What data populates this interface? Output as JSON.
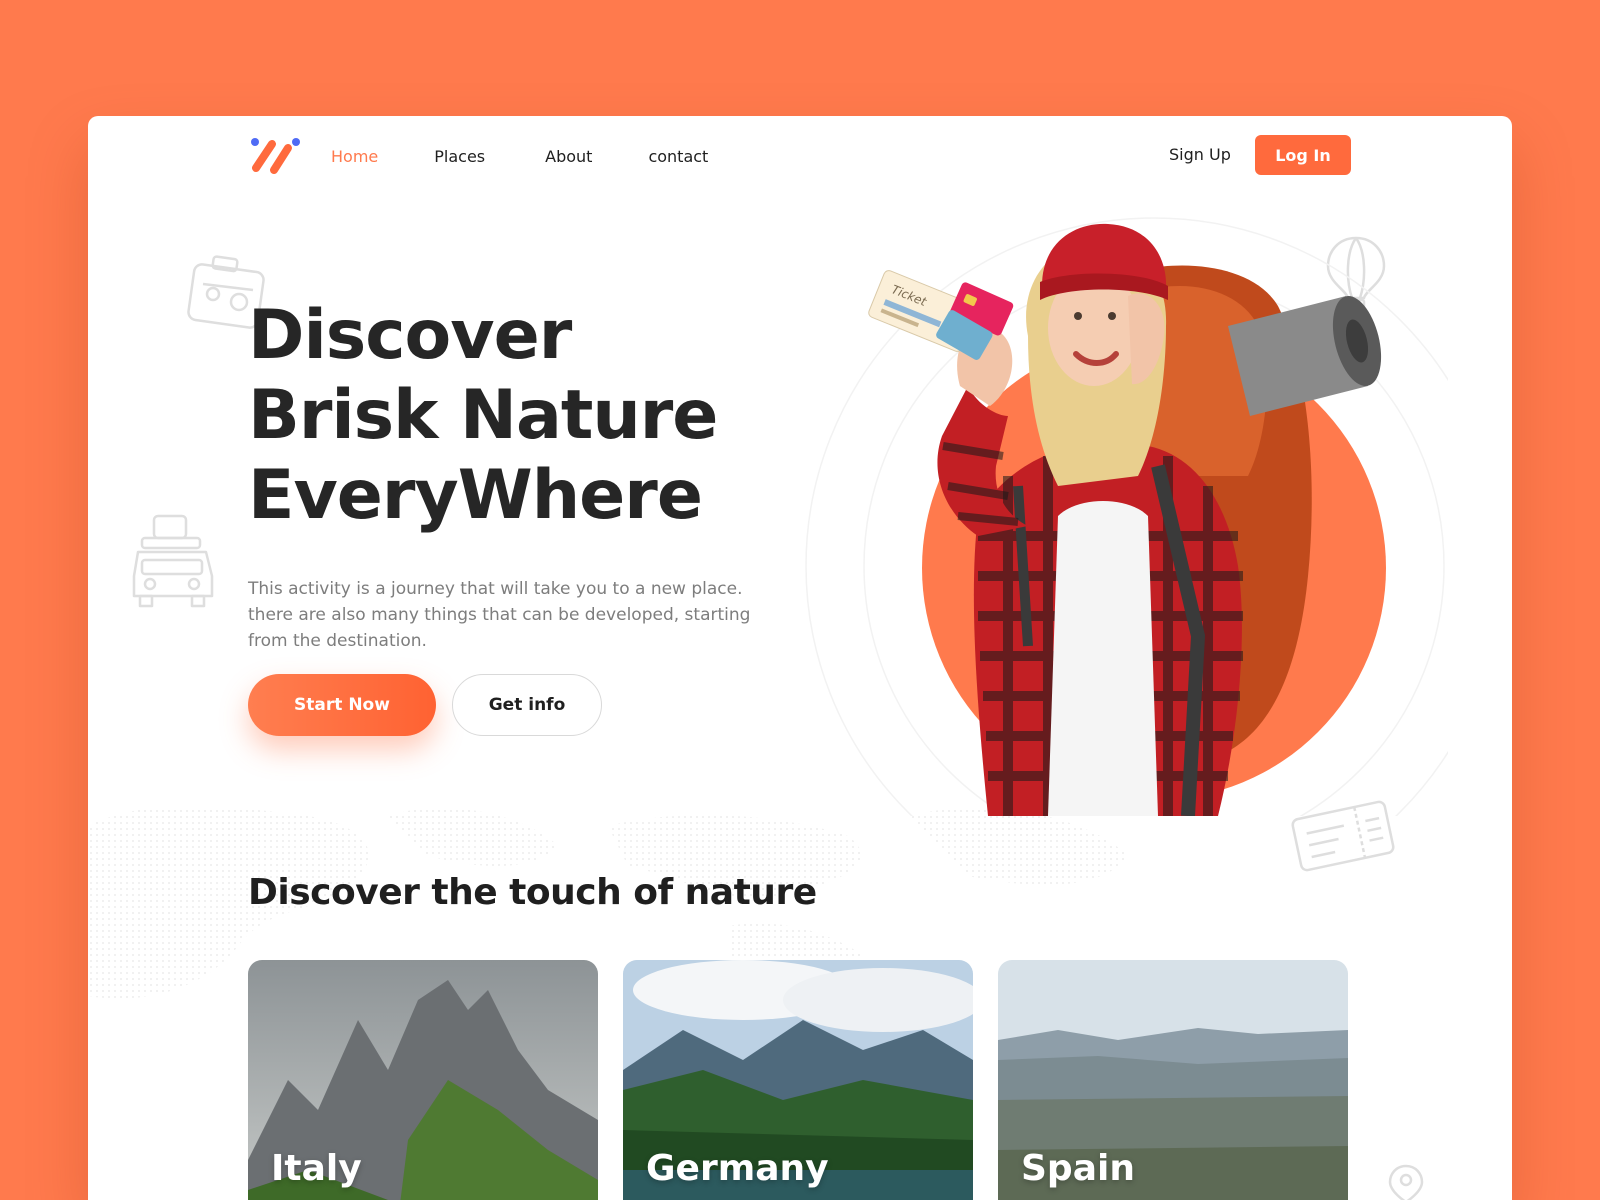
{
  "colors": {
    "background": "#FF7A4D",
    "accent": "#FF6A3D",
    "text_dark": "#262626",
    "text_muted": "#7d7d7d"
  },
  "header": {
    "logo_icon": "double-slash-logo",
    "nav": [
      {
        "label": "Home",
        "active": true
      },
      {
        "label": "Places",
        "active": false
      },
      {
        "label": "About",
        "active": false
      },
      {
        "label": "contact",
        "active": false
      }
    ],
    "signup_label": "Sign Up",
    "login_label": "Log In"
  },
  "hero": {
    "title_lines": [
      "Discover",
      "Brisk Nature",
      "EveryWhere"
    ],
    "description_lines": [
      "This activity is a journey that will take you to a new place.",
      "there are also many things that can be developed, starting",
      "from the destination."
    ],
    "start_label": "Start Now",
    "info_label": "Get info",
    "ticket_text": "Ticket"
  },
  "section": {
    "title": "Discover the touch of nature",
    "cards": [
      {
        "label": "Italy"
      },
      {
        "label": "Germany"
      },
      {
        "label": "Spain"
      }
    ]
  },
  "decorative_icons": [
    "suitcase-icon",
    "car-luggage-icon",
    "hot-air-balloon-icon",
    "boarding-pass-icon",
    "map-pin-icon"
  ]
}
